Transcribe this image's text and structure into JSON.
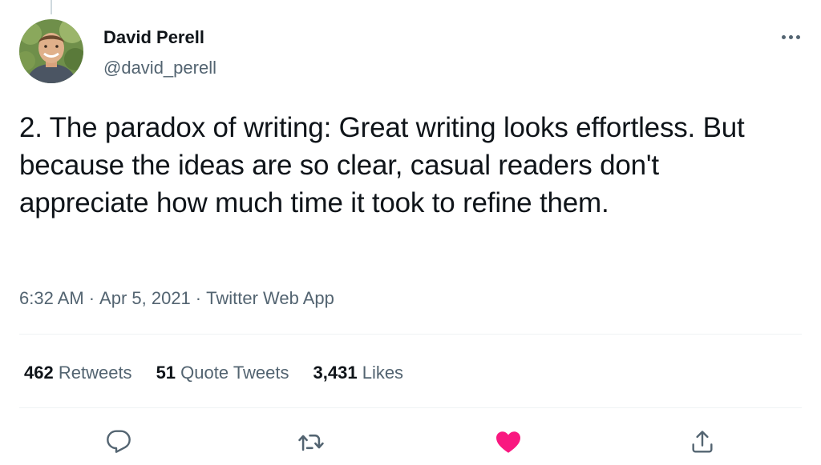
{
  "author": {
    "display_name": "David Perell",
    "handle": "@david_perell",
    "avatar_icon": "profile-photo"
  },
  "tweet": {
    "text": "2. The paradox of writing: Great writing looks effortless. But because the ideas are so clear, casual readers don't appreciate how much time it took to refine them.",
    "time": "6:32 AM",
    "separator": "·",
    "date": "Apr 5, 2021",
    "source": "Twitter Web App"
  },
  "stats": {
    "retweets": {
      "count": "462",
      "label": "Retweets"
    },
    "quotes": {
      "count": "51",
      "label": "Quote Tweets"
    },
    "likes": {
      "count": "3,431",
      "label": "Likes"
    }
  },
  "actions": {
    "reply_icon": "reply-icon",
    "retweet_icon": "retweet-icon",
    "like_icon": "heart-icon",
    "share_icon": "share-icon"
  },
  "colors": {
    "text": "#0f1419",
    "secondary": "#536471",
    "like": "#f91880",
    "divider": "#eff3f4"
  }
}
